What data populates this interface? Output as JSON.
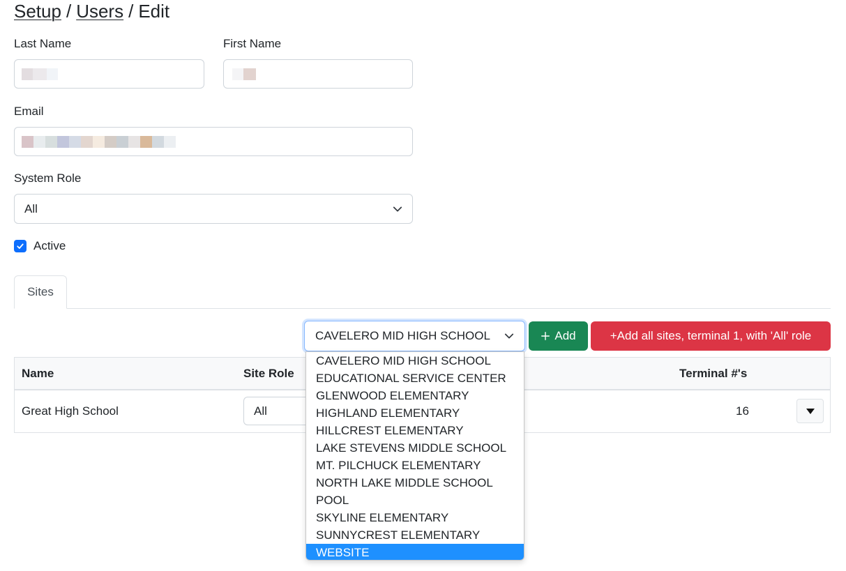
{
  "breadcrumb": {
    "setup": "Setup",
    "users": "Users",
    "current": "Edit",
    "sep": "/"
  },
  "form": {
    "last_name_label": "Last Name",
    "first_name_label": "First Name",
    "email_label": "Email",
    "system_role_label": "System Role",
    "system_role_value": "All",
    "active_label": "Active",
    "active_checked": true
  },
  "tabs": [
    {
      "label": "Sites"
    }
  ],
  "site_picker": {
    "selected": "CAVELERO MID HIGH SCHOOL",
    "add_label": "Add",
    "add_all_label": "+Add all sites, terminal 1, with 'All' role",
    "options": [
      "CAVELERO MID HIGH SCHOOL",
      "EDUCATIONAL SERVICE CENTER",
      "GLENWOOD ELEMENTARY",
      "HIGHLAND ELEMENTARY",
      "HILLCREST ELEMENTARY",
      "LAKE STEVENS MIDDLE SCHOOL",
      "MT. PILCHUCK ELEMENTARY",
      "NORTH LAKE MIDDLE SCHOOL",
      "POOL",
      "SKYLINE ELEMENTARY",
      "SUNNYCREST ELEMENTARY",
      "WEBSITE"
    ],
    "highlighted_index": 11
  },
  "table": {
    "headers": {
      "name": "Name",
      "site_role": "Site Role",
      "terminals": "Terminal #'s"
    },
    "rows": [
      {
        "name": "Great High School",
        "site_role": "All",
        "terminals": "16"
      }
    ]
  },
  "colors": {
    "primary": "#0d6efd",
    "success": "#198754",
    "danger": "#dc3545",
    "highlight": "#1e90ff"
  },
  "icons": {
    "plus": "plus-icon",
    "chevron": "chevron-down-icon",
    "caret": "caret-down-icon",
    "check": "check-icon"
  }
}
